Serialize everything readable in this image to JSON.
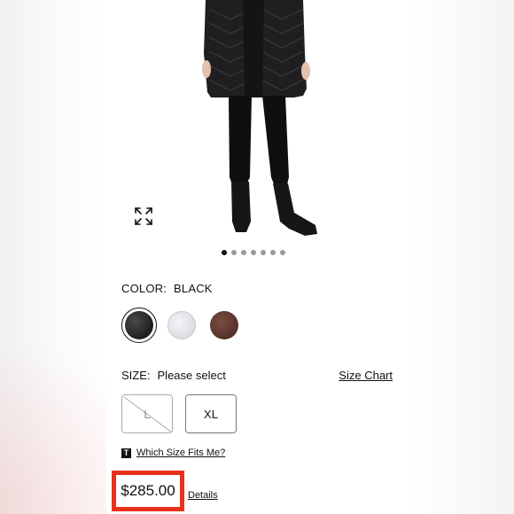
{
  "product": {
    "image_alt": "",
    "gallery_total": 7,
    "gallery_active": 1
  },
  "color": {
    "label": "COLOR:",
    "selected": "BLACK",
    "swatches": [
      {
        "name": "black",
        "hex": "#2b2b2b",
        "selected": true
      },
      {
        "name": "white",
        "hex": "#e6e6ee",
        "selected": false
      },
      {
        "name": "brown",
        "hex": "#5e3930",
        "selected": false
      }
    ]
  },
  "size": {
    "label": "SIZE:",
    "prompt": "Please select",
    "chart_link": "Size Chart",
    "options": [
      {
        "label": "L",
        "available": false
      },
      {
        "label": "XL",
        "available": true
      }
    ]
  },
  "fit": {
    "icon_letter": "T",
    "link": "Which Size Fits Me?"
  },
  "pricing": {
    "price": "$285.00",
    "details_link": "Details",
    "highlight_color": "#e8311c"
  }
}
